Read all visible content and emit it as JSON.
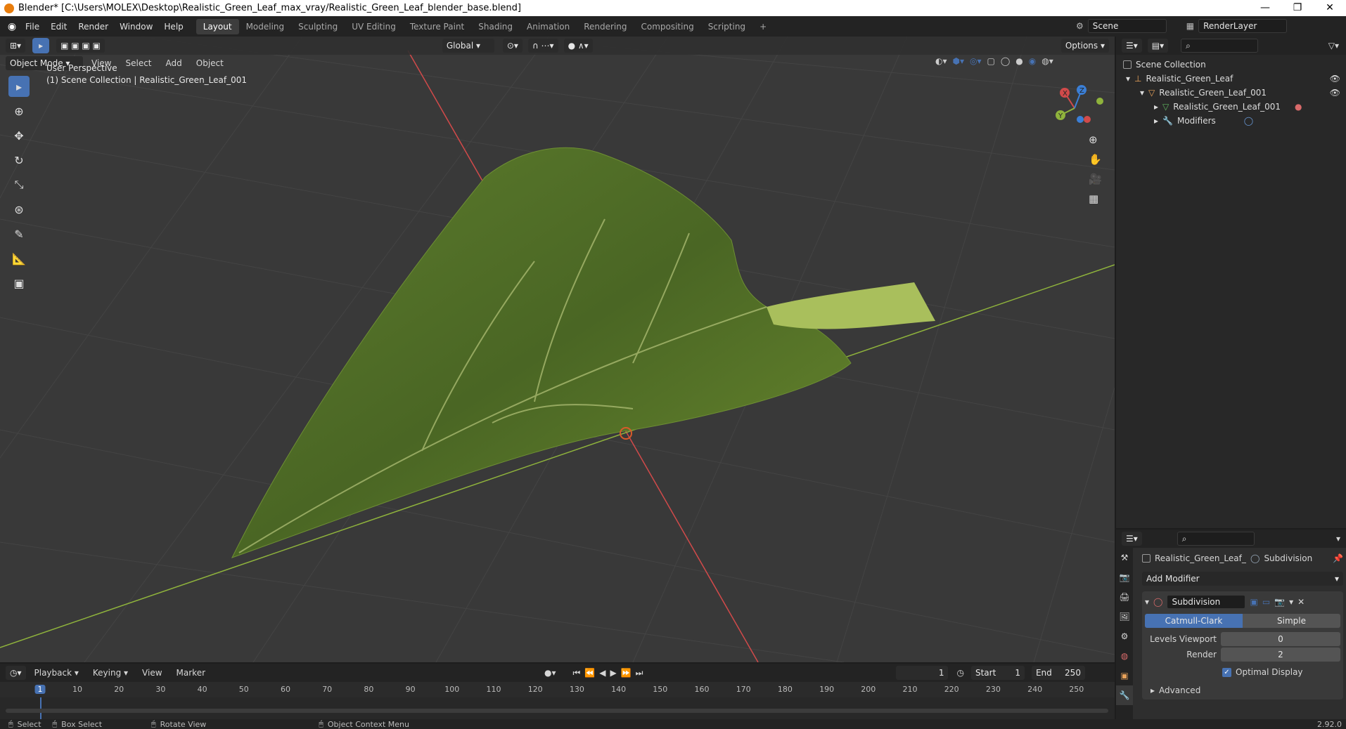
{
  "window": {
    "title": "Blender* [C:\\Users\\MOLEX\\Desktop\\Realistic_Green_Leaf_max_vray/Realistic_Green_Leaf_blender_base.blend]",
    "minimize": "—",
    "maximize": "❐",
    "close": "✕"
  },
  "menu": [
    "File",
    "Edit",
    "Render",
    "Window",
    "Help"
  ],
  "workspaces": [
    {
      "label": "Layout",
      "active": true
    },
    {
      "label": "Modeling"
    },
    {
      "label": "Sculpting"
    },
    {
      "label": "UV Editing"
    },
    {
      "label": "Texture Paint"
    },
    {
      "label": "Shading"
    },
    {
      "label": "Animation"
    },
    {
      "label": "Rendering"
    },
    {
      "label": "Compositing"
    },
    {
      "label": "Scripting"
    }
  ],
  "scene": "Scene",
  "render_layer": "RenderLayer",
  "viewport": {
    "mode": "Object Mode",
    "menus": [
      "View",
      "Select",
      "Add",
      "Object"
    ],
    "orientation": "Global",
    "options": "Options",
    "info_line1": "User Perspective",
    "info_line2": "(1) Scene Collection | Realistic_Green_Leaf_001",
    "gizmo_axes": {
      "x": "X",
      "y": "Y",
      "z": "Z"
    }
  },
  "outliner": {
    "root": "Scene Collection",
    "items": [
      {
        "label": "Realistic_Green_Leaf"
      },
      {
        "label": "Realistic_Green_Leaf_001"
      },
      {
        "label": "Realistic_Green_Leaf_001"
      },
      {
        "label": "Modifiers"
      }
    ]
  },
  "properties": {
    "object": "Realistic_Green_Leaf_0...",
    "modifier_tab": "Subdivision",
    "add_modifier": "Add Modifier",
    "modifier_name": "Subdivision",
    "algo": [
      "Catmull-Clark",
      "Simple"
    ],
    "levels_viewport_label": "Levels Viewport",
    "levels_viewport": "0",
    "render_label": "Render",
    "render": "2",
    "optimal_display": "Optimal Display",
    "advanced": "Advanced"
  },
  "timeline": {
    "menus": [
      "Playback",
      "Keying",
      "View",
      "Marker"
    ],
    "current_frame": "1",
    "start_label": "Start",
    "start": "1",
    "end_label": "End",
    "end": "250",
    "ruler": [
      "1",
      "10",
      "20",
      "30",
      "40",
      "50",
      "60",
      "70",
      "80",
      "90",
      "100",
      "110",
      "120",
      "130",
      "140",
      "150",
      "160",
      "170",
      "180",
      "190",
      "200",
      "210",
      "220",
      "230",
      "240",
      "250"
    ]
  },
  "status": {
    "select": "Select",
    "box_select": "Box Select",
    "rotate": "Rotate View",
    "context": "Object Context Menu",
    "version": "2.92.0"
  },
  "colors": {
    "accent": "#4772b3",
    "x_axis": "#d14a4a",
    "y_axis": "#8fb33c",
    "z_axis": "#3b7fd6",
    "leaf": "#4f6b25"
  }
}
